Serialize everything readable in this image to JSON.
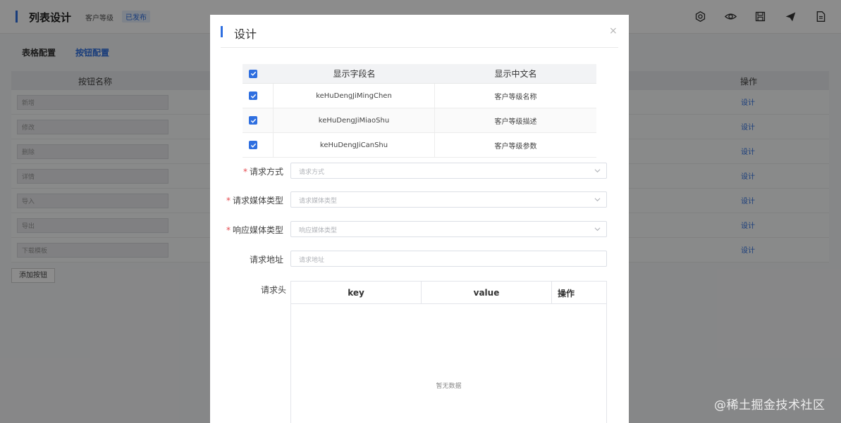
{
  "header": {
    "title": "列表设计",
    "subtitle": "客户等级",
    "status_badge": "已发布",
    "tools": [
      "settings-icon",
      "eye-icon",
      "save-icon",
      "send-icon",
      "document-icon"
    ]
  },
  "tabs": [
    {
      "label": "表格配置",
      "active": false
    },
    {
      "label": "按钮配置",
      "active": true
    }
  ],
  "button_table": {
    "col_name": "按钮名称",
    "col_op": "操作",
    "rows": [
      {
        "name": "新增",
        "op": "设计"
      },
      {
        "name": "修改",
        "op": "设计"
      },
      {
        "name": "删除",
        "op": "设计"
      },
      {
        "name": "详情",
        "op": "设计"
      },
      {
        "name": "导入",
        "op": "设计"
      },
      {
        "name": "导出",
        "op": "设计"
      },
      {
        "name": "下载模板",
        "op": "设计"
      }
    ],
    "add_button": "添加按钮"
  },
  "modal": {
    "title": "设计",
    "close": "×",
    "fields_table": {
      "col_field": "显示字段名",
      "col_cn": "显示中文名",
      "rows": [
        {
          "field": "keHuDengJiMingChen",
          "cn": "客户等级名称",
          "checked": true
        },
        {
          "field": "keHuDengJiMiaoShu",
          "cn": "客户等级描述",
          "checked": true
        },
        {
          "field": "keHuDengJiCanShu",
          "cn": "客户等级参数",
          "checked": true
        }
      ]
    },
    "form": {
      "method": {
        "label": "请求方式",
        "placeholder": "请求方式",
        "required": "*"
      },
      "req_media": {
        "label": "请求媒体类型",
        "placeholder": "请求媒体类型",
        "required": "*"
      },
      "resp_media": {
        "label": "响应媒体类型",
        "placeholder": "响应媒体类型",
        "required": "*"
      },
      "url": {
        "label": "请求地址",
        "placeholder": "请求地址"
      }
    },
    "headers": {
      "label": "请求头",
      "col_key": "key",
      "col_value": "value",
      "col_op": "操作",
      "empty_text": "暂无数据"
    }
  },
  "watermark": "@稀土掘金技术社区",
  "colors": {
    "accent": "#2f6fe0",
    "required": "#e5484d"
  }
}
